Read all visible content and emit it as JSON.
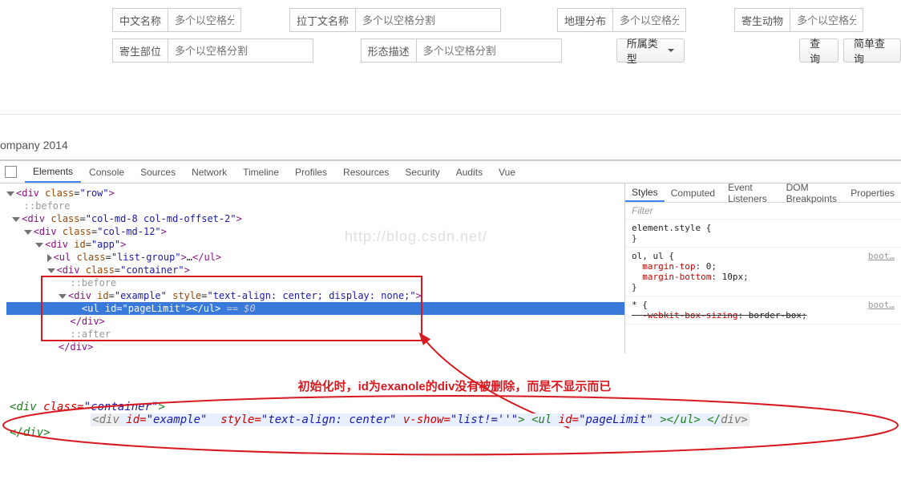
{
  "form": {
    "cn_name": {
      "label": "中文名称",
      "ph": "多个以空格分"
    },
    "latin_name": {
      "label": "拉丁文名称",
      "ph": "多个以空格分割"
    },
    "geo": {
      "label": "地理分布",
      "ph": "多个以空格分"
    },
    "host_animal": {
      "label": "寄生动物",
      "ph": "多个以空格分"
    },
    "host_part": {
      "label": "寄生部位",
      "ph": "多个以空格分割"
    },
    "morph": {
      "label": "形态描述",
      "ph": "多个以空格分割"
    },
    "type_label": "所属类型",
    "search": "查询",
    "simple_search": "简单查询"
  },
  "footer": "ompany 2014",
  "devtools": {
    "tabs": [
      "Elements",
      "Console",
      "Sources",
      "Network",
      "Timeline",
      "Profiles",
      "Resources",
      "Security",
      "Audits",
      "Vue"
    ],
    "active_tab": 0,
    "watermark": "http://blog.csdn.net/",
    "dom": {
      "l1": "<div class=\"row\">",
      "l1b": "::before",
      "l2": "<div class=\"col-md-8 col-md-offset-2\">",
      "l3": "<div class=\"col-md-12\">",
      "l4": "<div id=\"app\">",
      "l5a": "<ul class=\"list-group\">",
      "l5b": "…",
      "l5c": "</ul>",
      "l6": "<div class=\"container\">",
      "l6b": "::before",
      "l7": "<div id=\"example\" style=\"text-align: center; display: none;\">",
      "l8a": "<ul id=\"pageLimit\">",
      "l8b": "</ul>",
      "l8c": " == $0",
      "l9": "</div>",
      "l9b": "::after",
      "l10": "</div>"
    },
    "styles": {
      "tabs": [
        "Styles",
        "Computed",
        "Event Listeners",
        "DOM Breakpoints",
        "Properties"
      ],
      "filter": "Filter",
      "r1_sel": "element.style {",
      "r1_close": "}",
      "r2_sel": "ol, ul {",
      "r2_src": "boot…",
      "r2_p1_n": "margin-top",
      "r2_p1_v": "0",
      "r2_p2_n": "margin-bottom",
      "r2_p2_v": "10px",
      "r2_close": "}",
      "r3_sel": "* {",
      "r3_src": "boot…",
      "r3_p1_n": "-webkit-box-sizing",
      "r3_p1_v": "border-box"
    }
  },
  "annotation": "初始化时，id为exanole的div没有被删除，而是不显示而已",
  "wide_code": {
    "l1_a": "<div",
    "l1_b": " class=",
    "l1_c": "\"container\"",
    "l1_d": ">",
    "l2_a": "<div",
    "l2_b": " id=",
    "l2_c": "\"example\"",
    "l2_d": "  style=",
    "l2_e": "\"text-align: center\"",
    "l2_f": " v-show=",
    "l2_g": "\"list!=''\"",
    "l2_h": ">",
    "l2_i": " <ul",
    "l2_j": " id=",
    "l2_k": "\"pageLimit\"",
    "l2_l": " >",
    "l2_m": "</ul>",
    "l2_n": " </",
    "l2_o": "div",
    "l2_p": ">",
    "l3": "</div>"
  }
}
